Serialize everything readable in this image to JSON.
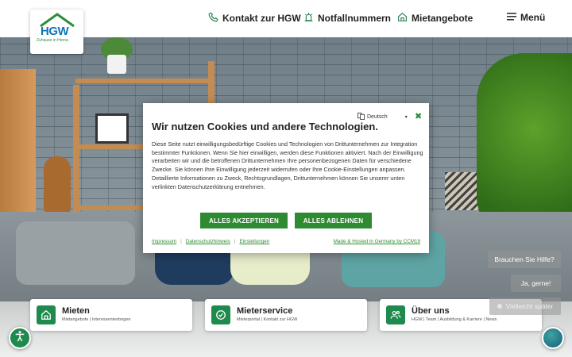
{
  "logo": {
    "brand": "HGW",
    "tagline": "Zuhause in Herne."
  },
  "nav": {
    "contact": "Kontakt zur HGW",
    "emergency": "Notfallnummern",
    "rentals": "Mietangebote",
    "menu": "Menü"
  },
  "cookie": {
    "language": "Deutsch",
    "title": "Wir nutzen Cookies und andere Technologien.",
    "body": "Diese Seite nutzt einwilligungsbedürftige Cookies und Technologien von Drittunternehmen zur Integration bestimmter Funktionen. Wenn Sie hier einwilligen, werden diese Funktionen aktiviert. Nach der Einwilligung verarbeiten wir und die betroffenen Drittunternehmen Ihre personenbezogenen Daten für verschiedene Zwecke. Sie können Ihre Einwilligung jederzeit widerrufen oder Ihre Cookie-Einstellungen anpassen. Detaillierte Informationen zu Zweck, Rechtsgrundlagen, Drittunternehmen können Sie unserer unten verlinkten Datenschutzerklärung entnehmen.",
    "accept": "ALLES AKZEPTIEREN",
    "reject": "ALLES ABLEHNEN",
    "link_imprint": "Impressum",
    "link_privacy": "Datenschutzhinweis",
    "link_settings": "Einstellungen",
    "hosted": "Made & Hosted in Germany by CCM19"
  },
  "cards": [
    {
      "title": "Mieten",
      "sub": "Mietangebote | Interessentenbogen"
    },
    {
      "title": "Mieterservice",
      "sub": "Mieterportal | Kontakt zur HGW"
    },
    {
      "title": "Über uns",
      "sub": "HGW | Team | Ausbildung & Karriere | News"
    }
  ],
  "help": {
    "question": "Brauchen Sie Hilfe?",
    "yes": "Ja, gerne!",
    "later": "Vielleicht später"
  },
  "colors": {
    "green": "#2e8b32",
    "blue": "#0f75b7",
    "teal": "#1f8a4e"
  },
  "icons": {
    "contact": "phone-icon",
    "emergency": "alarm-light-icon",
    "rentals": "house-icon",
    "menu": "hamburger-icon",
    "language": "translate-icon",
    "close": "close-icon",
    "accessibility": "accessibility-icon",
    "chat": "chat-avatar-icon"
  }
}
